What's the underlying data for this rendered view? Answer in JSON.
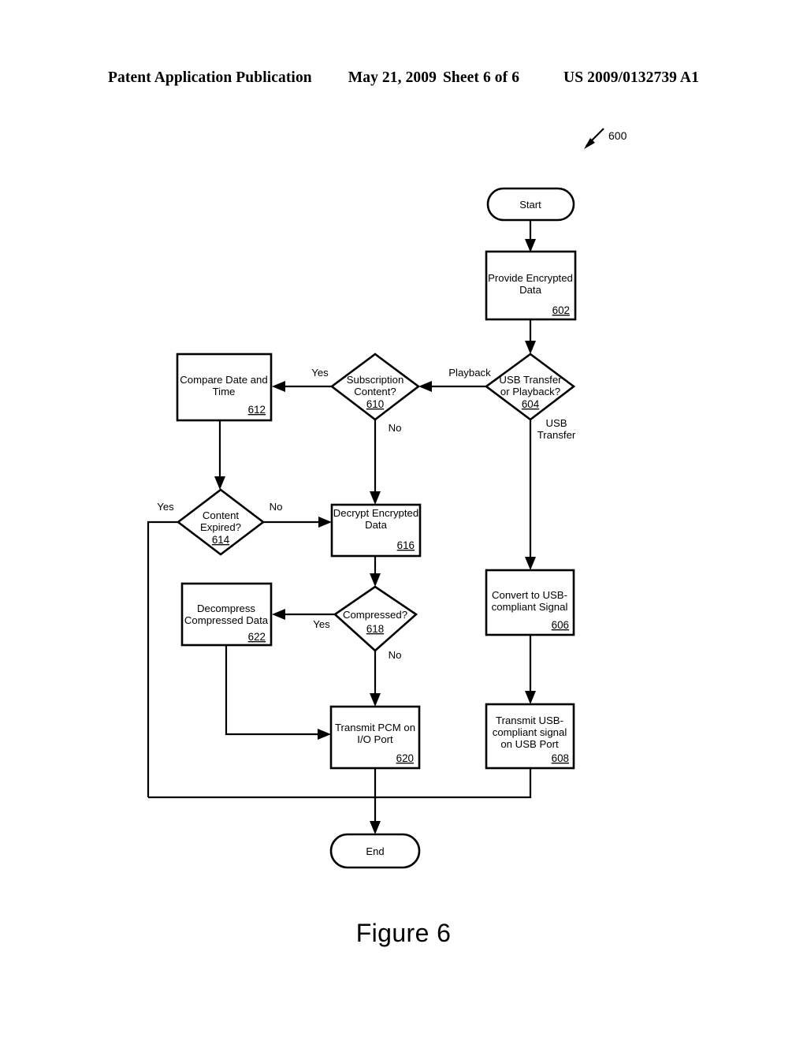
{
  "header": {
    "publication": "Patent Application Publication",
    "date": "May 21, 2009",
    "sheet": "Sheet 6 of 6",
    "patent_number": "US 2009/0132739 A1"
  },
  "figure": {
    "caption": "Figure 6",
    "diagram_ref": "600"
  },
  "chart_data": {
    "type": "diagram",
    "subtype": "flowchart",
    "title": "Figure 6",
    "reference_numeral": "600",
    "nodes": [
      {
        "id": "start",
        "shape": "terminator",
        "label": "Start",
        "ref": ""
      },
      {
        "id": "n602",
        "shape": "process",
        "label": "Provide Encrypted Data",
        "ref": "602"
      },
      {
        "id": "n604",
        "shape": "decision",
        "label": "USB Transfer or Playback?",
        "ref": "604"
      },
      {
        "id": "n610",
        "shape": "decision",
        "label": "Subscription Content?",
        "ref": "610"
      },
      {
        "id": "n612",
        "shape": "process",
        "label": "Compare Date and Time",
        "ref": "612"
      },
      {
        "id": "n614",
        "shape": "decision",
        "label": "Content Expired?",
        "ref": "614"
      },
      {
        "id": "n616",
        "shape": "process",
        "label": "Decrypt Encrypted Data",
        "ref": "616"
      },
      {
        "id": "n618",
        "shape": "decision",
        "label": "Compressed?",
        "ref": "618"
      },
      {
        "id": "n622",
        "shape": "process",
        "label": "Decompress Compressed Data",
        "ref": "622"
      },
      {
        "id": "n620",
        "shape": "process",
        "label": "Transmit PCM on I/O Port",
        "ref": "620"
      },
      {
        "id": "n606",
        "shape": "process",
        "label": "Convert to USB-compliant Signal",
        "ref": "606"
      },
      {
        "id": "n608",
        "shape": "process",
        "label": "Transmit USB-compliant signal on USB Port",
        "ref": "608"
      },
      {
        "id": "end",
        "shape": "terminator",
        "label": "End",
        "ref": ""
      }
    ],
    "edges": [
      {
        "from": "start",
        "to": "n602",
        "label": ""
      },
      {
        "from": "n602",
        "to": "n604",
        "label": ""
      },
      {
        "from": "n604",
        "to": "n610",
        "label": "Playback"
      },
      {
        "from": "n604",
        "to": "n606",
        "label": "USB Transfer"
      },
      {
        "from": "n610",
        "to": "n612",
        "label": "Yes"
      },
      {
        "from": "n610",
        "to": "n616",
        "label": "No"
      },
      {
        "from": "n612",
        "to": "n614",
        "label": ""
      },
      {
        "from": "n614",
        "to": "end",
        "label": "Yes"
      },
      {
        "from": "n614",
        "to": "n616",
        "label": "No"
      },
      {
        "from": "n616",
        "to": "n618",
        "label": ""
      },
      {
        "from": "n618",
        "to": "n622",
        "label": "Yes"
      },
      {
        "from": "n618",
        "to": "n620",
        "label": "No"
      },
      {
        "from": "n622",
        "to": "n620",
        "label": ""
      },
      {
        "from": "n620",
        "to": "end",
        "label": ""
      },
      {
        "from": "n606",
        "to": "n608",
        "label": ""
      },
      {
        "from": "n608",
        "to": "end",
        "label": ""
      }
    ]
  },
  "nodes": {
    "start": {
      "label": "Start"
    },
    "n602": {
      "line1": "Provide Encrypted",
      "line2": "Data",
      "ref": "602"
    },
    "n604": {
      "line1": "USB Transfer",
      "line2": "or Playback?",
      "ref": "604"
    },
    "n610": {
      "line1": "Subscription",
      "line2": "Content?",
      "ref": "610"
    },
    "n612": {
      "line1": "Compare Date and",
      "line2": "Time",
      "ref": "612"
    },
    "n614": {
      "line1": "Content",
      "line2": "Expired?",
      "ref": "614"
    },
    "n616": {
      "line1": "Decrypt Encrypted",
      "line2": "Data",
      "ref": "616"
    },
    "n618": {
      "line1": "Compressed?",
      "line2": "",
      "ref": "618"
    },
    "n622": {
      "line1": "Decompress",
      "line2": "Compressed Data",
      "ref": "622"
    },
    "n620": {
      "line1": "Transmit PCM on",
      "line2": "I/O Port",
      "ref": "620"
    },
    "n606": {
      "line1": "Convert to USB-",
      "line2": "compliant Signal",
      "ref": "606"
    },
    "n608": {
      "line1": "Transmit USB-",
      "line2": "compliant signal",
      "line3": "on USB Port",
      "ref": "608"
    },
    "end": {
      "label": "End"
    }
  },
  "edge_labels": {
    "playback": "Playback",
    "usb_transfer_1": "USB",
    "usb_transfer_2": "Transfer",
    "yes_610": "Yes",
    "no_610": "No",
    "yes_614": "Yes",
    "no_614": "No",
    "yes_618": "Yes",
    "no_618": "No"
  },
  "colors": {
    "stroke": "#000000",
    "fill": "#ffffff",
    "background": "#ffffff"
  }
}
